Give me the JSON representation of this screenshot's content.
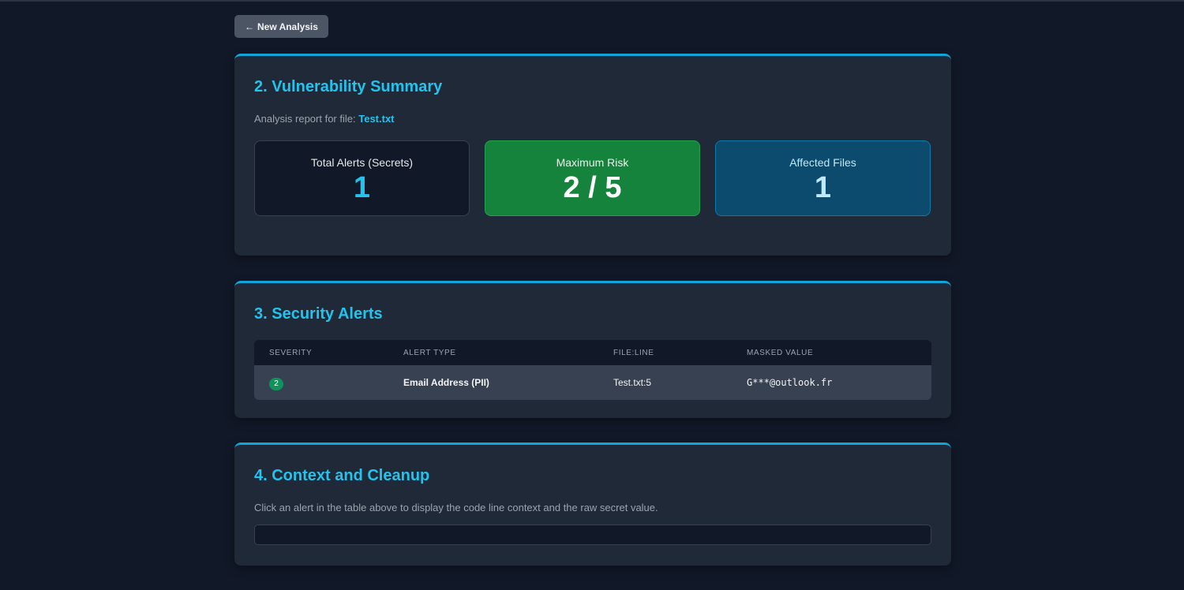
{
  "nav": {
    "back_arrow": "←",
    "back_label": "New Analysis"
  },
  "summary": {
    "title": "2. Vulnerability Summary",
    "report_prefix": "Analysis report for file:",
    "filename": "Test.txt",
    "stats": {
      "total": {
        "label": "Total Alerts (Secrets)",
        "value": "1"
      },
      "risk": {
        "label": "Maximum Risk",
        "value": "2 / 5"
      },
      "files": {
        "label": "Affected Files",
        "value": "1"
      }
    }
  },
  "alerts": {
    "title": "3. Security Alerts",
    "columns": [
      "SEVERITY",
      "ALERT TYPE",
      "FILE:LINE",
      "MASKED VALUE"
    ],
    "rows": [
      {
        "severity": "2",
        "type": "Email Address (PII)",
        "location": "Test.txt:5",
        "masked": "G***@outlook.fr"
      }
    ]
  },
  "context": {
    "title": "4. Context and Cleanup",
    "hint": "Click an alert in the table above to display the code line context and the raw secret value.",
    "content": ""
  },
  "colors": {
    "accent": "#22c3ee",
    "card_bg": "#1f2937",
    "page_bg": "#111827",
    "risk_green": "#16833d",
    "files_blue": "#0c4a6e",
    "severity_badge": "#10935b"
  }
}
